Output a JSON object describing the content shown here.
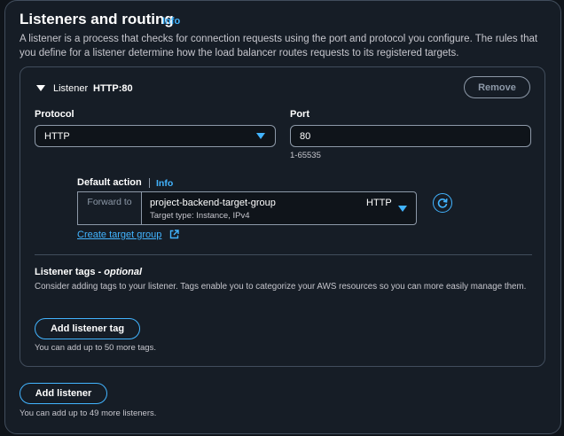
{
  "header": {
    "title": "Listeners and routing",
    "info": "Info",
    "description": "A listener is a process that checks for connection requests using the port and protocol you configure. The rules that you define for a listener determine how the load balancer routes requests to its registered targets."
  },
  "listener": {
    "label": "Listener",
    "name": "HTTP:80",
    "remove_label": "Remove",
    "protocol": {
      "label": "Protocol",
      "value": "HTTP"
    },
    "port": {
      "label": "Port",
      "value": "80",
      "hint": "1-65535"
    },
    "default_action": {
      "label": "Default action",
      "info": "Info",
      "action_prefix": "Forward to",
      "target_group_name": "project-backend-target-group",
      "target_group_details": "Target type: Instance, IPv4",
      "target_group_protocol": "HTTP",
      "create_link": "Create target group"
    },
    "tags": {
      "title": "Listener tags",
      "optional": "optional",
      "description": "Consider adding tags to your listener. Tags enable you to categorize your AWS resources so you can more easily manage them.",
      "add_label": "Add listener tag",
      "hint": "You can add up to 50 more tags."
    }
  },
  "add_listener": {
    "label": "Add listener",
    "hint": "You can add up to 49 more listeners."
  },
  "colors": {
    "accent": "#42b4ff",
    "background": "#0f141a",
    "panel": "#161d26",
    "border": "#414d5c"
  }
}
